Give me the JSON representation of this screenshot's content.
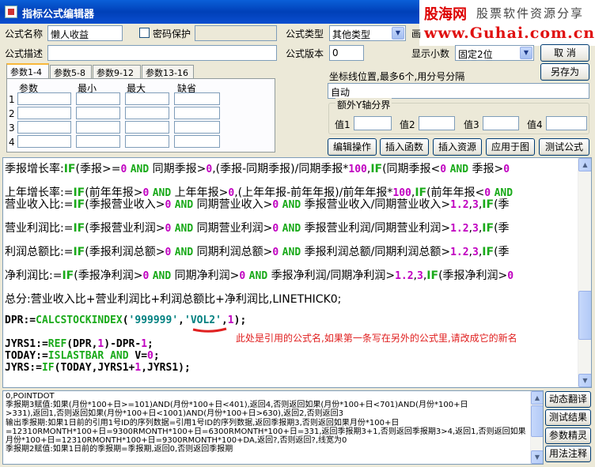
{
  "window": {
    "title": "指标公式编辑器"
  },
  "brand": {
    "logo_text": "股海网",
    "slogan": "股票软件资源分享",
    "url": "www.Guhai.com.cn"
  },
  "form": {
    "name_label": "公式名称",
    "name_value": "懒人收益",
    "password_label": "密码保护",
    "type_label": "公式类型",
    "type_value": "其他类型",
    "draw_label": "画",
    "desc_label": "公式描述",
    "version_label": "公式版本",
    "version_value": "0",
    "decimal_label": "显示小数",
    "decimal_value": "固定2位",
    "cancel_label": "取  消",
    "saveas_label": "另存为"
  },
  "tabs": [
    "参数1-4",
    "参数5-8",
    "参数9-12",
    "参数13-16"
  ],
  "param_table": {
    "headers": [
      "参数",
      "最小",
      "最大",
      "缺省"
    ],
    "rows": [
      "1",
      "2",
      "3",
      "4"
    ]
  },
  "coord": {
    "label": "坐标线位置,最多6个,用分号分隔",
    "value": "自动",
    "extra_y_label": "额外Y轴分界",
    "values": [
      "值1",
      "值2",
      "值3",
      "值4"
    ]
  },
  "actions": [
    "编辑操作",
    "插入函数",
    "插入资源",
    "应用于图",
    "测试公式"
  ],
  "code": {
    "lines": [
      "季报增长率:IF(季报>=0 AND 同期季报>0,(季报-同期季报)/同期季报*100,IF(同期季报<0 AND 季报>0",
      "上年增长率:=IF(前年年报>0 AND 上年年报>0,(上年年报-前年年报)/前年年报*100,IF(前年年报<0 AND",
      "营业收入比:=IF(季报营业收入>0 AND 同期营业收入>0 AND 季报营业收入/同期营业收入>1.2,3,IF(季",
      "营业利润比:=IF(季报营业利润>0 AND 同期营业利润>0 AND 季报营业利润/同期营业利润>1.2,3,IF(季",
      "利润总额比:=IF(季报利润总额>0 AND 同期利润总额>0 AND 季报利润总额/同期利润总额>1.2,3,IF(季",
      "净利润比:=IF(季报净利润>0 AND 同期净利润>0 AND 季报净利润/同期净利润>1.2,3,IF(季报净利润>0",
      "总分:营业收入比+营业利润比+利润总额比+净利润比,LINETHICK0;",
      "DPR:=CALCSTOCKINDEX('999999','VOL2',1);",
      "JYRS1:=REF(DPR,1)-DPR-1;",
      "TODAY:=ISLASTBAR AND V=0;",
      "JYRS:=IF(TODAY,JYRS1+1,JYRS1);"
    ],
    "annotation": "此处是引用的公式名,如果第一条写在另外的公式里,请改成它的新名"
  },
  "output": {
    "lines": [
      "0,POINTDOT",
      "季报期3赋值:如果(月份*100+日>=101)AND(月份*100+日<401),返回4,否则返回如果(月份*100+日<701)AND(月份*100+日",
      ">331),返回1,否则返回如果(月份*100+日<1001)AND(月份*100+日>630),返回2,否则返回3",
      "输出季报期:如果1日前的引用1号ID的序列数据=引用1号ID的序列数据,返回季报期3,否则返回如果月份*100+日",
      "=12310RMONTH*100+日=9300RMONTH*100+日=6300RMONTH*100+日=331,返回季报期3+1,否则返回季报期3>4,返回1,否则返回如果",
      "月份*100+日=12310RMONTH*100+日=9300RMONTH*100+DA,返回?,否则返回?,线宽为0",
      "季报期2赋值:如果1日前的季报期=季报期,返回0,否则返回季报期"
    ]
  },
  "side_buttons": [
    "动态翻译",
    "测试结果",
    "参数精灵",
    "用法注释"
  ]
}
